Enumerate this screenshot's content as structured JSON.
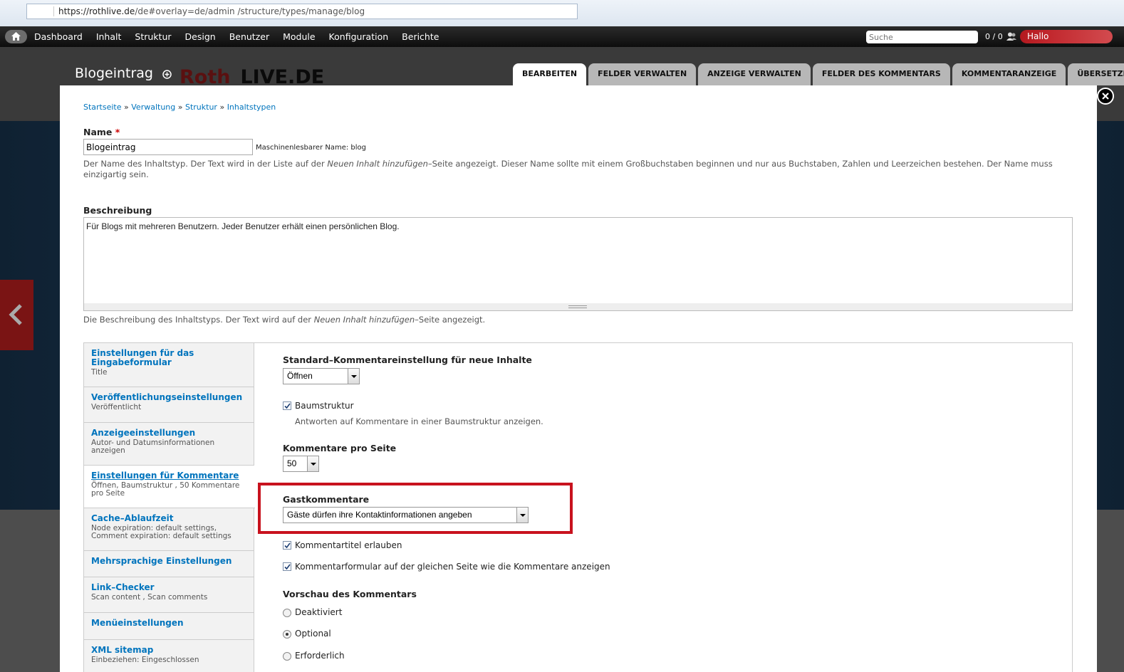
{
  "browser": {
    "url_host": "https://rothlive.de",
    "url_path": "/de#overlay=de/admin /structure/types/manage/blog"
  },
  "toolbar": {
    "menu": [
      "Dashboard",
      "Inhalt",
      "Struktur",
      "Design",
      "Benutzer",
      "Module",
      "Konfiguration",
      "Berichte"
    ],
    "search_placeholder": "Suche",
    "user_count": "0 / 0",
    "hello": "Hallo"
  },
  "header": {
    "title": "Blogeintrag",
    "logo_part1": "Roth",
    "logo_part2": "LIVE.DE",
    "tabs": [
      "Bearbeiten",
      "Felder verwalten",
      "Anzeige verwalten",
      "Felder des Kommentars",
      "Kommentaranzeige",
      "Übersetzen"
    ]
  },
  "breadcrumb": [
    "Startseite",
    "Verwaltung",
    "Struktur",
    "Inhaltstypen"
  ],
  "form": {
    "name_label": "Name",
    "name_required": "*",
    "name_value": "Blogeintrag",
    "machine_name": "Maschinenlesbarer Name: blog",
    "name_help_1": "Der Name des Inhaltstyp. Der Text wird in der Liste auf der ",
    "name_help_em": "Neuen Inhalt hinzufügen",
    "name_help_2": "–Seite angezeigt. Dieser Name sollte mit einem Großbuchstaben beginnen und nur aus Buchstaben, Zahlen und Leerzeichen bestehen. Der Name muss einzigartig sein.",
    "desc_label": "Beschreibung",
    "desc_value": "Für Blogs mit mehreren Benutzern. Jeder Benutzer erhält einen persönlichen Blog.",
    "desc_help_1": "Die Beschreibung des Inhaltstyps. Der Text wird auf der ",
    "desc_help_em": "Neuen Inhalt hinzufügen",
    "desc_help_2": "–Seite angezeigt."
  },
  "vtabs": [
    {
      "title": "Einstellungen für das Eingabeformular",
      "summary": "Title"
    },
    {
      "title": "Veröffentlichungseinstellungen",
      "summary": "Veröffentlicht"
    },
    {
      "title": "Anzeigeeinstellungen",
      "summary": "Autor- und Datumsinformationen anzeigen"
    },
    {
      "title": "Einstellungen für Kommentare",
      "summary": "Öffnen, Baumstruktur , 50 Kommentare pro Seite"
    },
    {
      "title": "Cache–Ablaufzeit",
      "summary": "Node expiration: default settings, Comment expiration: default settings"
    },
    {
      "title": "Mehrsprachige Einstellungen",
      "summary": ""
    },
    {
      "title": "Link–Checker",
      "summary": "Scan content , Scan comments"
    },
    {
      "title": "Menüeinstellungen",
      "summary": ""
    },
    {
      "title": "XML sitemap",
      "summary": "Einbeziehen: Eingeschlossen"
    }
  ],
  "comments": {
    "default_label": "Standard–Kommentareinstellung für neue Inhalte",
    "default_value": "Öffnen",
    "threading_label": "Baumstruktur",
    "threading_help": "Antworten auf Kommentare in einer Baumstruktur anzeigen.",
    "per_page_label": "Kommentare pro Seite",
    "per_page_value": "50",
    "anon_label": "Gastkommentare",
    "anon_value": "Gäste dürfen ihre Kontaktinformationen angeben",
    "subject_label": "Kommentartitel erlauben",
    "form_location_label": "Kommentarformular auf der gleichen Seite wie die Kommentare anzeigen",
    "preview_label": "Vorschau des Kommentars",
    "preview_options": [
      "Deaktiviert",
      "Optional",
      "Erforderlich"
    ],
    "preview_selected": "Optional"
  },
  "colors": {
    "link": "#0074bd",
    "highlight": "#c8121e",
    "hello_button": "#c1272d"
  }
}
